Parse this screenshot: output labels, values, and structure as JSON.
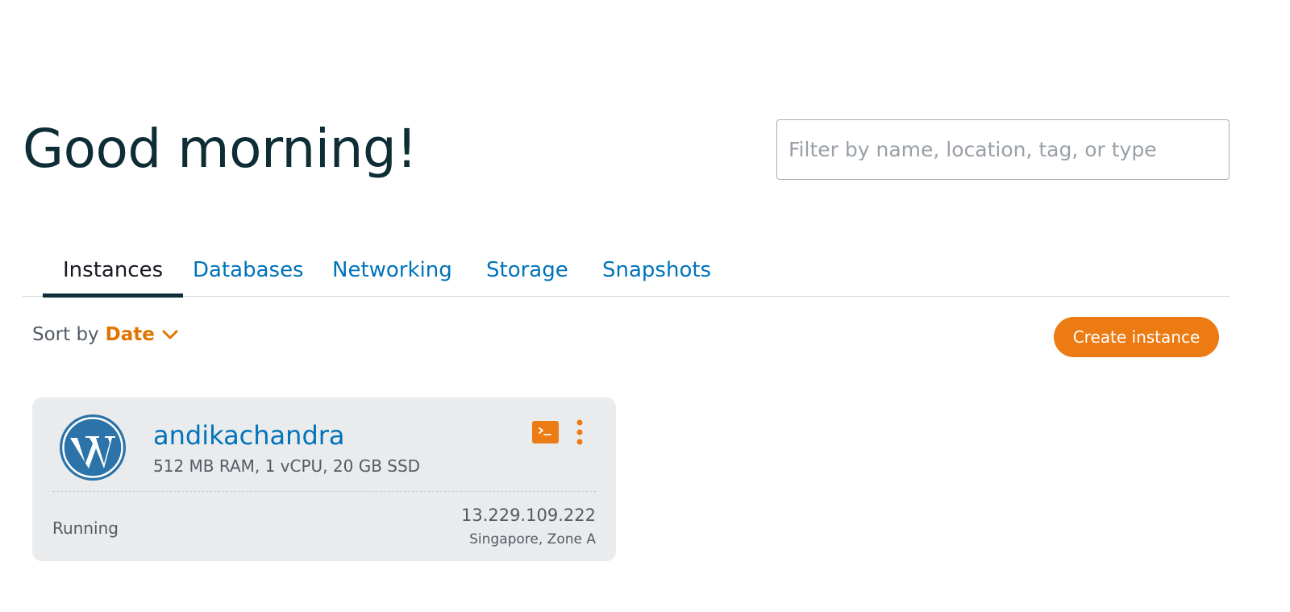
{
  "header": {
    "greeting": "Good morning!",
    "search_placeholder": "Filter by name, location, tag, or type"
  },
  "tabs": [
    {
      "label": "Instances",
      "active": true
    },
    {
      "label": "Databases",
      "active": false
    },
    {
      "label": "Networking",
      "active": false
    },
    {
      "label": "Storage",
      "active": false
    },
    {
      "label": "Snapshots",
      "active": false
    }
  ],
  "toolbar": {
    "sort_label": "Sort by",
    "sort_value": "Date",
    "create_label": "Create instance"
  },
  "instances": [
    {
      "name": "andikachandra",
      "specs": "512 MB RAM, 1 vCPU, 20 GB SSD",
      "status": "Running",
      "ip": "13.229.109.222",
      "location": "Singapore, Zone A",
      "blueprint_icon": "wordpress-icon"
    }
  ],
  "colors": {
    "accent_orange": "#eb7b12",
    "link_blue": "#0073bb",
    "heading_dark": "#0f2d35",
    "card_bg": "#e9ebed"
  }
}
